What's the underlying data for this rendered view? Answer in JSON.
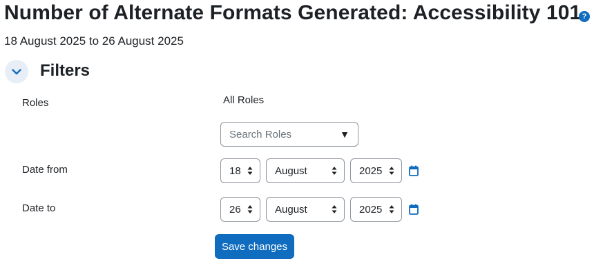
{
  "header": {
    "title": "Number of Alternate Formats Generated: Accessibility 101",
    "subtitle": "18 August 2025 to 26 August 2025",
    "help_icon": "question-circle-icon"
  },
  "filters": {
    "section_title": "Filters",
    "toggle_icon": "chevron-down-icon",
    "roles": {
      "label": "Roles",
      "value": "All Roles",
      "search_placeholder": "Search Roles"
    },
    "date_from": {
      "label": "Date from",
      "day": "18",
      "month": "August",
      "year": "2025"
    },
    "date_to": {
      "label": "Date to",
      "day": "26",
      "month": "August",
      "year": "2025"
    },
    "save_label": "Save changes"
  },
  "colors": {
    "accent": "#0f6cbf",
    "text": "#1d2125",
    "toggle_bg": "#e7eef7"
  }
}
